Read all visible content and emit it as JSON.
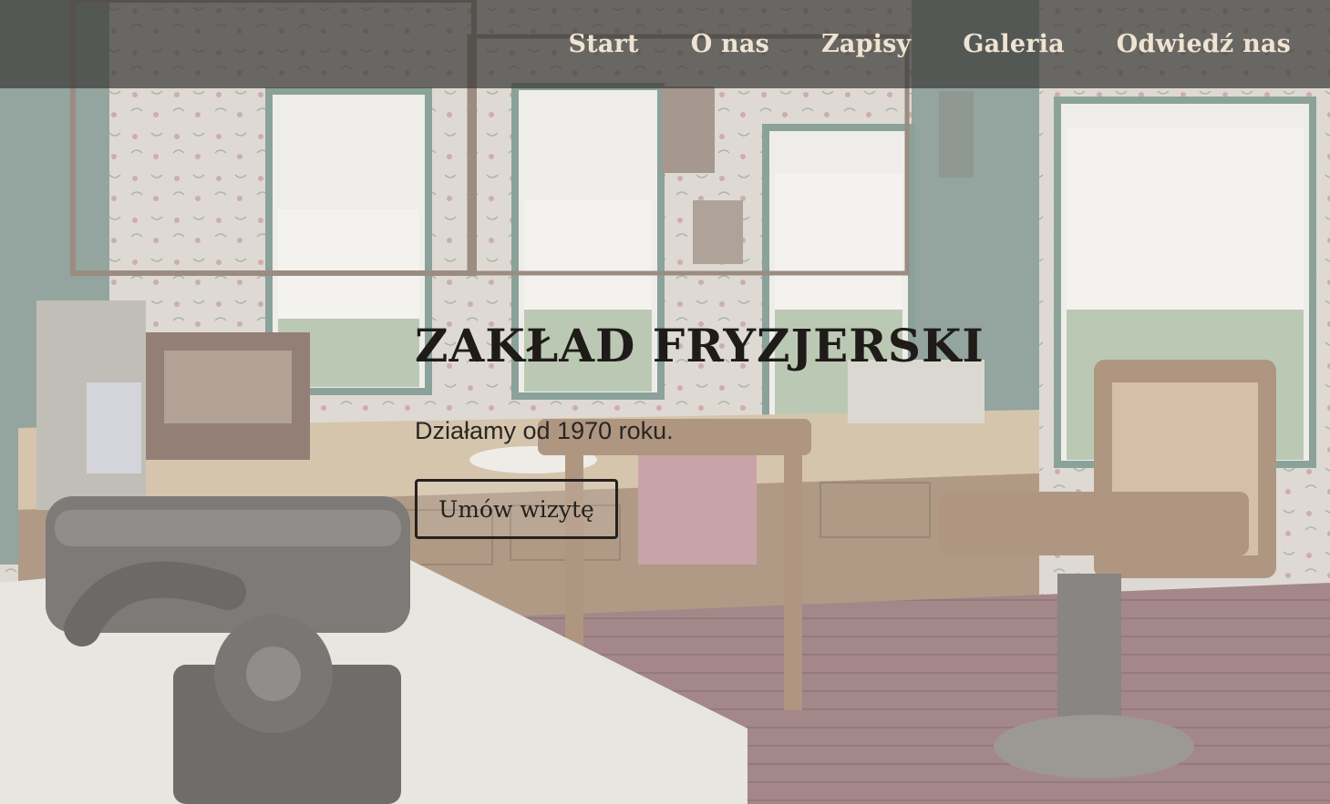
{
  "nav": {
    "items": [
      {
        "label": "Start"
      },
      {
        "label": "O nas"
      },
      {
        "label": "Zapisy"
      },
      {
        "label": "Galeria"
      },
      {
        "label": "Odwiedź nas"
      }
    ]
  },
  "hero": {
    "title": "ZAKŁAD FRYZJERSKI",
    "subtitle": "Działamy od 1970 roku.",
    "cta_label": "Umów wizytę"
  },
  "colors": {
    "nav_background": "#3c3a38",
    "nav_text": "#efe3d2",
    "heading_text": "#1e1b18"
  }
}
